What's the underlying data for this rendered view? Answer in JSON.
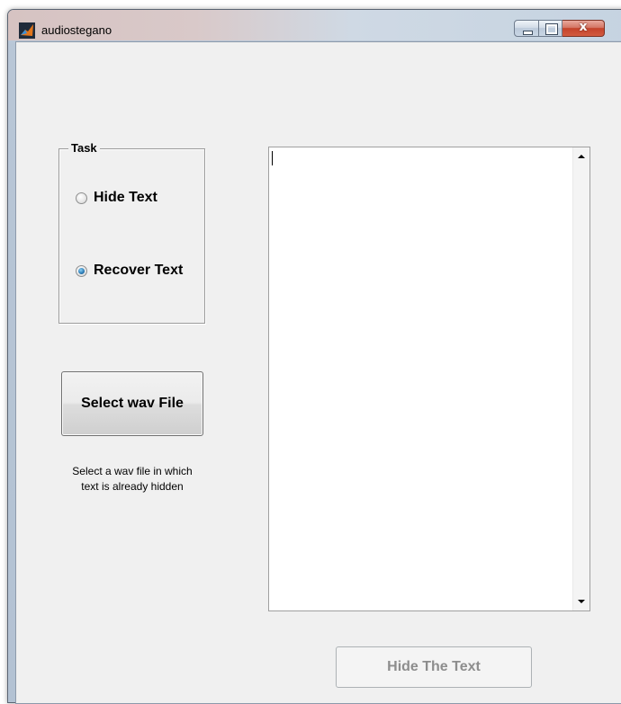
{
  "window": {
    "title": "audiostegano",
    "close_glyph": "x"
  },
  "task": {
    "legend": "Task",
    "options": [
      {
        "label": "Hide Text",
        "checked": false
      },
      {
        "label": "Recover Text",
        "checked": true
      }
    ]
  },
  "select_button": {
    "label": "Select wav File"
  },
  "hint": {
    "line1": "Select a wav file in which",
    "line2": "text is already hidden"
  },
  "text_box": {
    "value": ""
  },
  "action_button": {
    "label": "Hide The Text",
    "enabled": false
  },
  "colors": {
    "accent_radio": "#2f7fb8",
    "close_button": "#c4432b",
    "disabled_text": "#8d8d8d"
  }
}
